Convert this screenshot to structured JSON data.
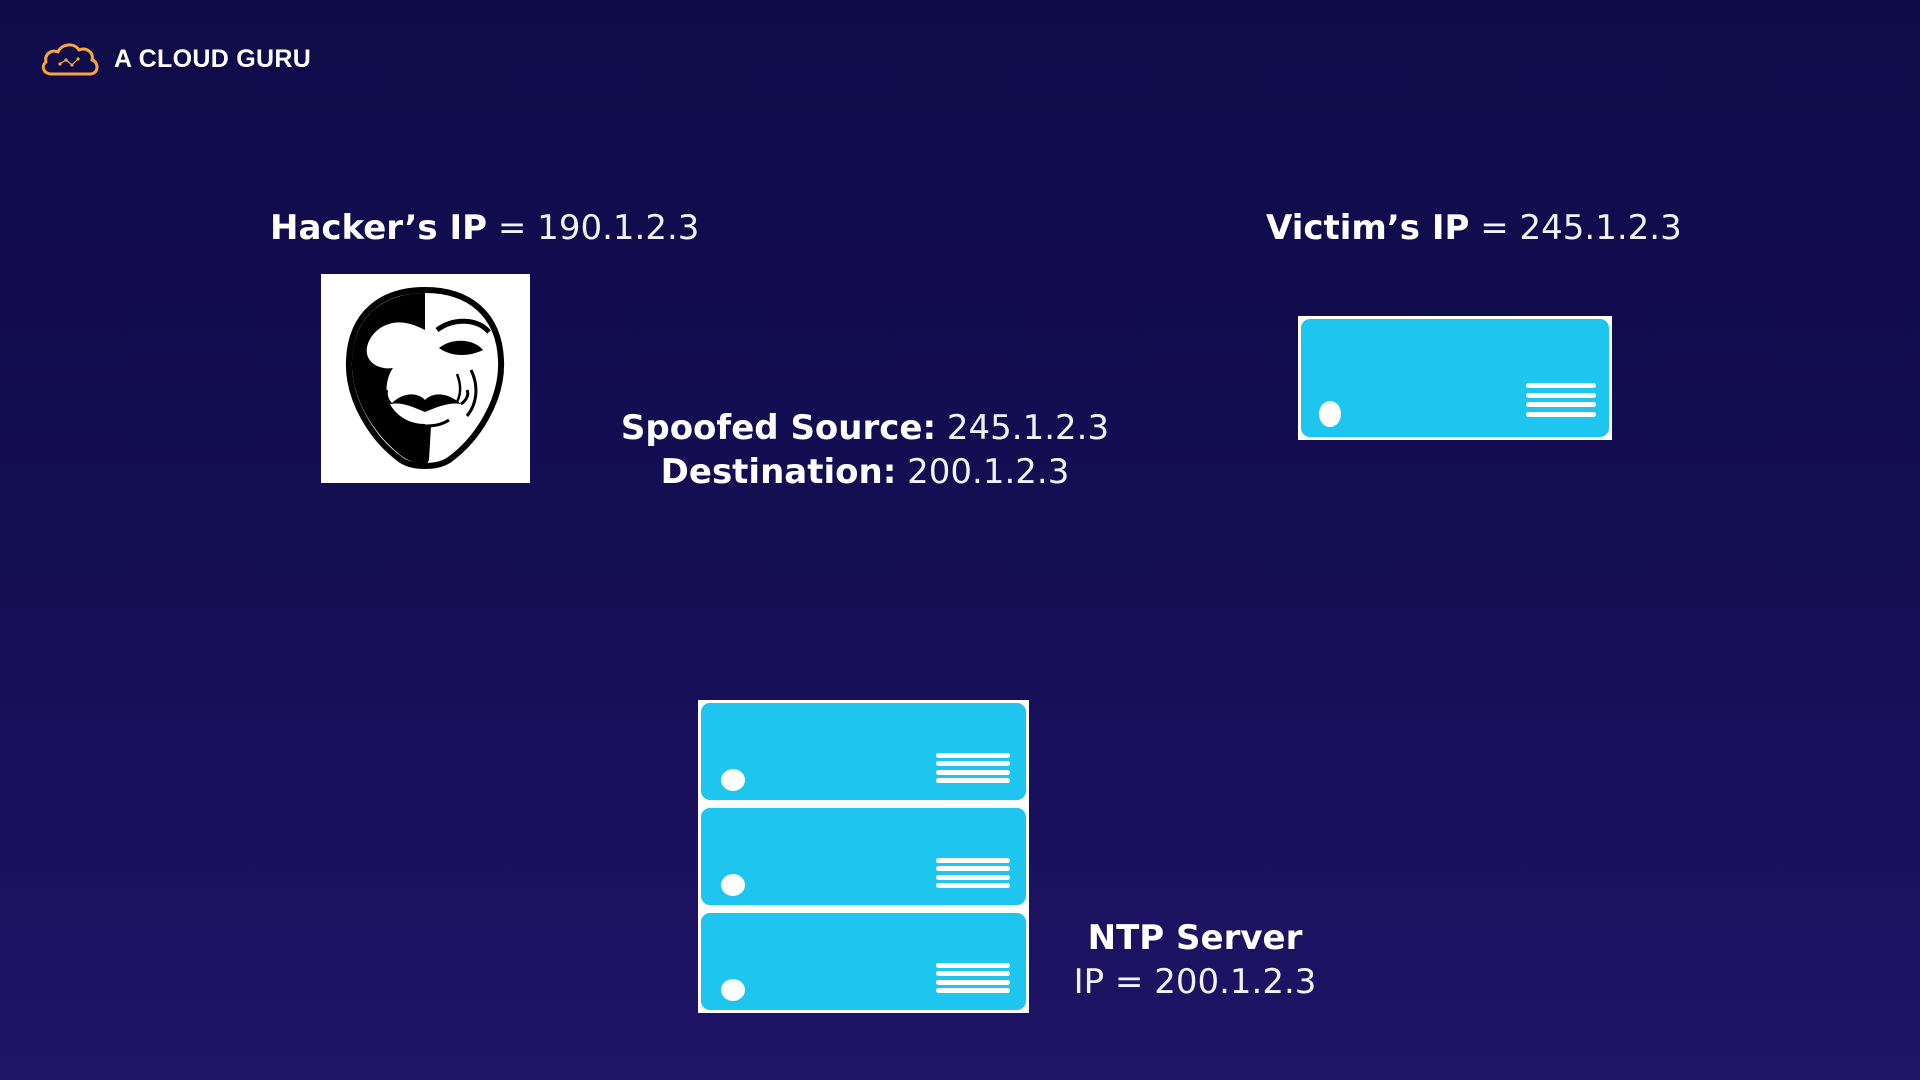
{
  "brand": {
    "name": "A CLOUD GURU",
    "accent": "#f7a541"
  },
  "hacker": {
    "key": "Hacker’s IP",
    "value": "= 190.1.2.3",
    "icon": "anonymous-mask-icon"
  },
  "victim": {
    "key": "Victim’s IP",
    "value": "= 245.1.2.3",
    "icon": "server-icon"
  },
  "packet": {
    "source_key": "Spoofed Source:",
    "source_value": "245.1.2.3",
    "dest_key": "Destination:",
    "dest_value": "200.1.2.3"
  },
  "ntp": {
    "title": "NTP Server",
    "ip": "IP = 200.1.2.3",
    "icon": "server-rack-icon"
  },
  "colors": {
    "background": "#130d52",
    "server": "#1ec5ee",
    "text": "#ffffff"
  }
}
